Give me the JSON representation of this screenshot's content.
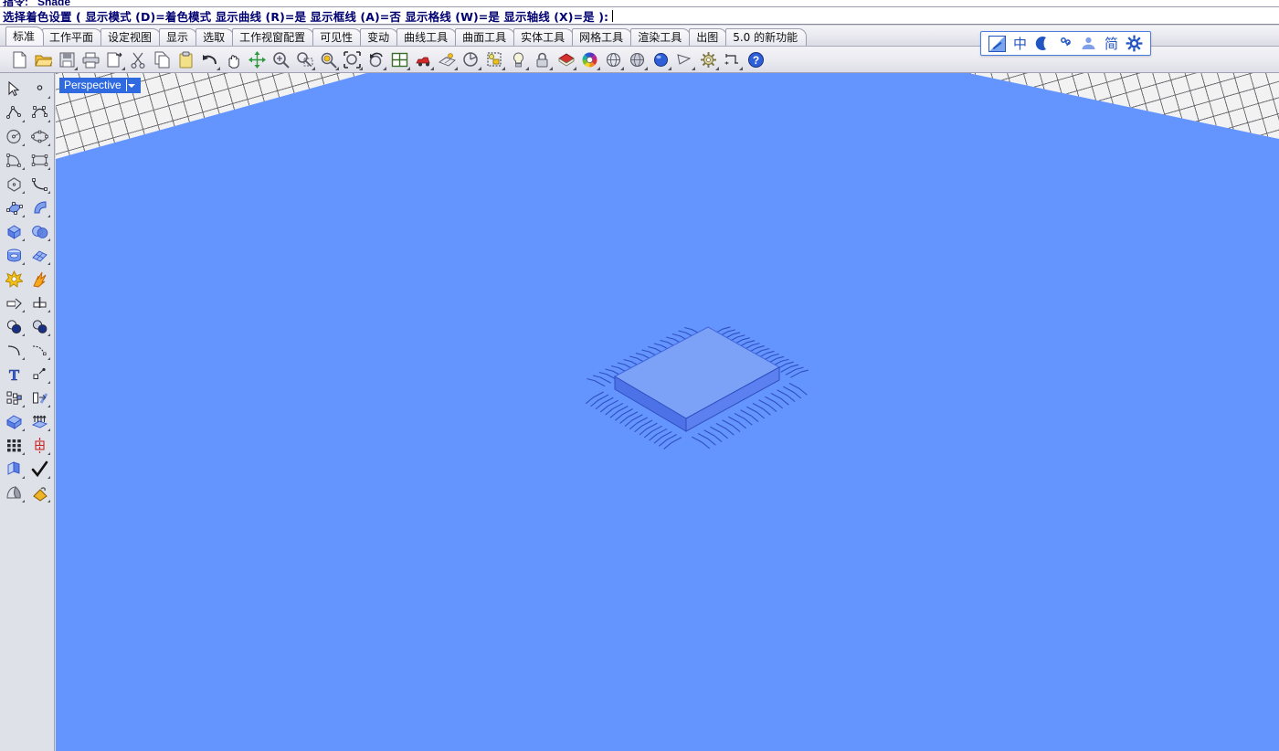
{
  "window": {
    "command_history_text": "指令: _Shade",
    "prompt": {
      "label": "选择着色设置",
      "full_text": "选择着色设置 ( 显示模式 (D)=着色模式  显示曲线 (R)=是  显示框线 (A)=否  显示格线 (W)=是  显示轴线 (X)=是 ):",
      "options": [
        {
          "name": "显示模式",
          "key": "D",
          "value": "着色模式"
        },
        {
          "name": "显示曲线",
          "key": "R",
          "value": "是"
        },
        {
          "name": "显示框线",
          "key": "A",
          "value": "否"
        },
        {
          "name": "显示格线",
          "key": "W",
          "value": "是"
        },
        {
          "name": "显示轴线",
          "key": "X",
          "value": "是"
        }
      ]
    }
  },
  "tabs": {
    "active_index": 0,
    "items": [
      {
        "label": "标准"
      },
      {
        "label": "工作平面"
      },
      {
        "label": "设定视图"
      },
      {
        "label": "显示"
      },
      {
        "label": "选取"
      },
      {
        "label": "工作视窗配置"
      },
      {
        "label": "可见性"
      },
      {
        "label": "变动"
      },
      {
        "label": "曲线工具"
      },
      {
        "label": "曲面工具"
      },
      {
        "label": "实体工具"
      },
      {
        "label": "网格工具"
      },
      {
        "label": "渲染工具"
      },
      {
        "label": "出图"
      },
      {
        "label": "5.0 的新功能"
      }
    ]
  },
  "toolbar": {
    "buttons": [
      {
        "icon": "new-file-icon",
        "tooltip": "新建",
        "flyout": false
      },
      {
        "icon": "open-folder-icon",
        "tooltip": "打开",
        "flyout": false
      },
      {
        "icon": "save-icon",
        "tooltip": "保存",
        "flyout": true
      },
      {
        "icon": "print-icon",
        "tooltip": "打印",
        "flyout": false
      },
      {
        "icon": "copy-page-icon",
        "tooltip": "复制到剪贴板",
        "flyout": true
      },
      {
        "icon": "cut-scissors-icon",
        "tooltip": "剪切",
        "flyout": false
      },
      {
        "icon": "copy-icon",
        "tooltip": "复制",
        "flyout": false
      },
      {
        "icon": "paste-icon",
        "tooltip": "粘贴",
        "flyout": false
      },
      {
        "icon": "undo-icon",
        "tooltip": "复原",
        "flyout": true
      },
      {
        "icon": "pan-hand-icon",
        "tooltip": "平移视图",
        "flyout": false
      },
      {
        "icon": "move-cross-icon",
        "tooltip": "移动",
        "flyout": false
      },
      {
        "icon": "zoom-in-icon",
        "tooltip": "放大",
        "flyout": false
      },
      {
        "icon": "zoom-window-icon",
        "tooltip": "框选缩放",
        "flyout": true
      },
      {
        "icon": "zoom-extents-icon",
        "tooltip": "缩放至最大范围",
        "flyout": true
      },
      {
        "icon": "zoom-selected-icon",
        "tooltip": "缩放至选取物件",
        "flyout": true
      },
      {
        "icon": "rotate-view-icon",
        "tooltip": "旋转视图",
        "flyout": true
      },
      {
        "icon": "viewport-four-icon",
        "tooltip": "四视图",
        "flyout": true
      },
      {
        "icon": "render-car-icon",
        "tooltip": "渲染",
        "flyout": true
      },
      {
        "icon": "shade-plane-icon",
        "tooltip": "着色",
        "flyout": true
      },
      {
        "icon": "analyze-circle-icon",
        "tooltip": "分析",
        "flyout": true
      },
      {
        "icon": "object-properties-icon",
        "tooltip": "物件属性",
        "flyout": true
      },
      {
        "icon": "light-bulb-icon",
        "tooltip": "灯光",
        "flyout": true
      },
      {
        "icon": "lock-icon",
        "tooltip": "锁定",
        "flyout": true
      },
      {
        "icon": "layer-icon",
        "tooltip": "图层",
        "flyout": true
      },
      {
        "icon": "color-wheel-icon",
        "tooltip": "颜色",
        "flyout": true
      },
      {
        "icon": "wireframe-sphere-icon",
        "tooltip": "线框显示",
        "flyout": true
      },
      {
        "icon": "shaded-sphere-icon",
        "tooltip": "着色显示",
        "flyout": true
      },
      {
        "icon": "rendered-sphere-icon",
        "tooltip": "渲染显示",
        "flyout": true
      },
      {
        "icon": "camera-flag-icon",
        "tooltip": "视角",
        "flyout": true
      },
      {
        "icon": "gear-options-icon",
        "tooltip": "选项",
        "flyout": true
      },
      {
        "icon": "dimension-icon",
        "tooltip": "尺寸标注",
        "flyout": true
      },
      {
        "icon": "help-icon",
        "tooltip": "帮助",
        "flyout": false
      }
    ]
  },
  "sidebar": {
    "buttons": [
      {
        "icon": "select-arrow-icon",
        "tooltip": "选取物件",
        "flyout": false
      },
      {
        "icon": "point-icon",
        "tooltip": "点",
        "flyout": true
      },
      {
        "icon": "polyline-icon",
        "tooltip": "多重直线",
        "flyout": true
      },
      {
        "icon": "control-point-curve-icon",
        "tooltip": "控制点曲线",
        "flyout": true
      },
      {
        "icon": "circle-icon",
        "tooltip": "圆",
        "flyout": true
      },
      {
        "icon": "ellipse-icon",
        "tooltip": "椭圆",
        "flyout": true
      },
      {
        "icon": "arc-triangle-icon",
        "tooltip": "圆弧",
        "flyout": true
      },
      {
        "icon": "rectangle-icon",
        "tooltip": "矩形",
        "flyout": true
      },
      {
        "icon": "polygon-icon",
        "tooltip": "多边形",
        "flyout": true
      },
      {
        "icon": "curve-blend-icon",
        "tooltip": "曲线混接",
        "flyout": true
      },
      {
        "icon": "surface-from-points-icon",
        "tooltip": "控制点建立曲面",
        "flyout": true
      },
      {
        "icon": "sweep-surface-icon",
        "tooltip": "单轨扫掠",
        "flyout": true
      },
      {
        "icon": "box-icon",
        "tooltip": "立方体",
        "flyout": true
      },
      {
        "icon": "sphere-boolean-icon",
        "tooltip": "布尔运算",
        "flyout": true
      },
      {
        "icon": "cylinder-icon",
        "tooltip": "圆柱体",
        "flyout": true
      },
      {
        "icon": "mesh-plane-icon",
        "tooltip": "网格平面",
        "flyout": true
      },
      {
        "icon": "explode-icon",
        "tooltip": "炸开",
        "flyout": false
      },
      {
        "icon": "flash-icon",
        "tooltip": "爆炸效果",
        "flyout": false
      },
      {
        "icon": "trim-icon",
        "tooltip": "修剪",
        "flyout": true
      },
      {
        "icon": "split-icon",
        "tooltip": "分割",
        "flyout": true
      },
      {
        "icon": "boolean-union-icon",
        "tooltip": "布尔联集",
        "flyout": true
      },
      {
        "icon": "boolean-diff-icon",
        "tooltip": "布尔差集",
        "flyout": true
      },
      {
        "icon": "fillet-curve-icon",
        "tooltip": "圆角",
        "flyout": true
      },
      {
        "icon": "chamfer-curve-icon",
        "tooltip": "斜角",
        "flyout": true
      },
      {
        "icon": "text-icon",
        "tooltip": "文字",
        "flyout": false
      },
      {
        "icon": "point-object-icon",
        "tooltip": "物件点",
        "flyout": true
      },
      {
        "icon": "group-icon",
        "tooltip": "群组",
        "flyout": true
      },
      {
        "icon": "move-object-icon",
        "tooltip": "移动",
        "flyout": true
      },
      {
        "icon": "extrude-solid-icon",
        "tooltip": "挤出实体",
        "flyout": true
      },
      {
        "icon": "extrude-up-icon",
        "tooltip": "挤出曲面",
        "flyout": true
      },
      {
        "icon": "array-grid-icon",
        "tooltip": "矩形阵列",
        "flyout": true
      },
      {
        "icon": "mirror-icon",
        "tooltip": "镜像",
        "flyout": true
      },
      {
        "icon": "offset-surface-icon",
        "tooltip": "偏移曲面",
        "flyout": true
      },
      {
        "icon": "check-icon",
        "tooltip": "检查",
        "flyout": true
      },
      {
        "icon": "shade-object-icon",
        "tooltip": "着色物件",
        "flyout": true
      },
      {
        "icon": "paint-bucket-icon",
        "tooltip": "材质",
        "flyout": true
      }
    ]
  },
  "viewport": {
    "label": "Perspective",
    "background_color": "#6494fe",
    "grid_visible": true,
    "display_mode": "着色模式",
    "model": {
      "name": "qfp-ic-chip",
      "description": "方形扁平封装集成电路芯片 3D 模型",
      "body_color": "#7ba2f7",
      "pin_color": "#2f4fc4",
      "edge_color": "#3355cc"
    }
  },
  "ime": {
    "items": [
      {
        "icon": "ime-logo-icon",
        "label": ""
      },
      {
        "icon": "chinese-mode-icon",
        "label": "中"
      },
      {
        "icon": "halfwidth-moon-icon",
        "label": ""
      },
      {
        "icon": "punctuation-icon",
        "label": ""
      },
      {
        "icon": "user-icon",
        "label": ""
      },
      {
        "icon": "simplified-mode-icon",
        "label": "简"
      },
      {
        "icon": "ime-settings-gear-icon",
        "label": ""
      }
    ]
  }
}
